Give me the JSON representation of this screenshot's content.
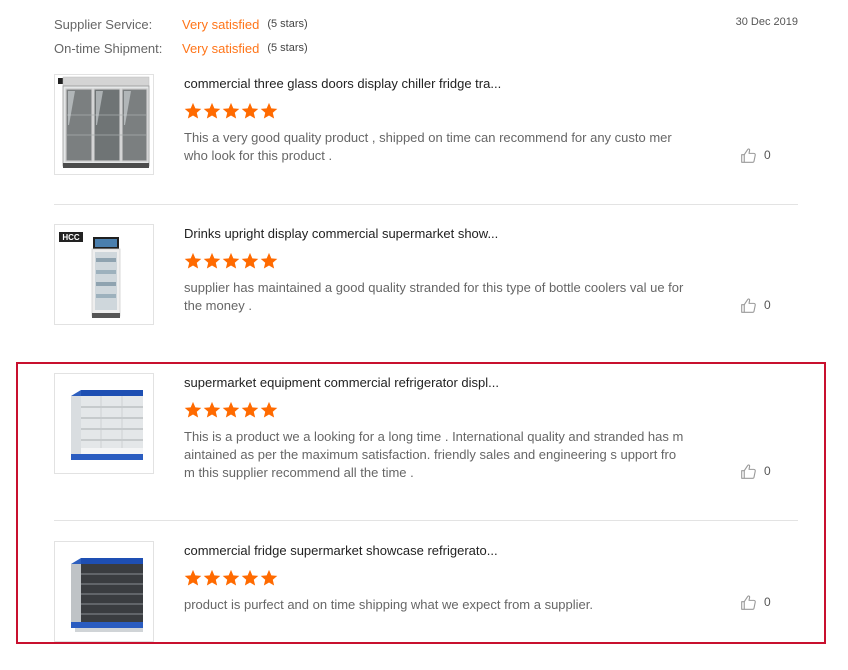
{
  "summary": {
    "supplier_service": {
      "label": "Supplier Service:",
      "value": "Very satisfied",
      "note": "(5 stars)"
    },
    "on_time_shipment": {
      "label": "On-time Shipment:",
      "value": "Very satisfied",
      "note": "(5 stars)"
    },
    "date": "30 Dec 2019"
  },
  "reviews": [
    {
      "title": "commercial three glass doors display chiller fridge tra...",
      "stars": 5,
      "text": "This a very good quality product , shipped on time can recommend for any custo mer who look for this product .",
      "likes": "0",
      "image": "three-door-chiller-image"
    },
    {
      "title": "Drinks upright display commercial supermarket show...",
      "stars": 5,
      "text": "supplier has maintained a good quality stranded for this type of bottle coolers val ue for the money .",
      "likes": "0",
      "image": "upright-display-cooler-image",
      "image_logo": "HCC"
    },
    {
      "title": "supermarket equipment commercial refrigerator displ...",
      "stars": 5,
      "text": "This is a product we a looking for a long time . International quality and stranded has maintained as per the maximum satisfaction. friendly sales and engineering s upport from this supplier recommend all the time .",
      "likes": "0",
      "image": "open-multideck-refrigerator-image"
    },
    {
      "title": "commercial fridge supermarket showcase refrigerato...",
      "stars": 5,
      "text": "product is purfect and on time shipping  what we expect from a supplier.",
      "likes": "0",
      "image": "open-showcase-refrigerator-image"
    }
  ],
  "colors": {
    "accent": "#ff7519",
    "star": "#ff6a00",
    "highlight_border": "#c8102e",
    "separator": "#e3e3e3"
  },
  "icons": {
    "star": "star-icon",
    "like": "thumbs-up-icon"
  }
}
